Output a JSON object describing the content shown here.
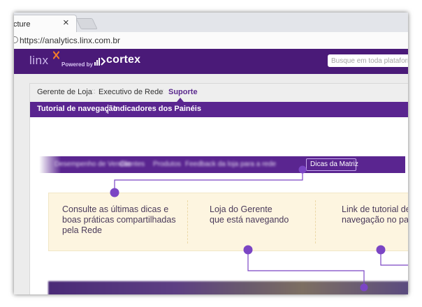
{
  "browser": {
    "tab_title": "cture",
    "tab_close": "×",
    "url": "https://analytics.linx.com.br"
  },
  "header": {
    "logo": "linx",
    "powered_by": "Powered by",
    "brand": "cortex",
    "search_placeholder": "Busque em toda plataforma",
    "colors": {
      "header_bg": "#4a1a78",
      "accent": "#5a2590"
    }
  },
  "nav": {
    "items": [
      {
        "label": "Gerente de Loja"
      },
      {
        "label": "Executivo de Rede"
      },
      {
        "label": "Suporte"
      }
    ],
    "separator": "::",
    "active_index": 2
  },
  "subnav": {
    "items": [
      {
        "label": "Tutorial de navegação"
      },
      {
        "label": "Indicadores dos Painéis"
      }
    ]
  },
  "menubar": {
    "items": [
      {
        "label": "Desempenho de Vendas"
      },
      {
        "label": "Clientes"
      },
      {
        "label": "Produtos"
      },
      {
        "label": "Feedback da loja para a rede"
      }
    ],
    "highlighted": "Dicas da Matriz"
  },
  "callouts": [
    {
      "text": "Consulte as últimas dicas e\nboas práticas compartilhadas\npela Rede"
    },
    {
      "text": "Loja do Gerente\nque está navegando"
    },
    {
      "text": "Link de tutorial de\nnavegação no painel"
    }
  ],
  "icons": [
    "close-icon",
    "lock-icon",
    "linx-x-icon",
    "cortex-mark-icon"
  ]
}
